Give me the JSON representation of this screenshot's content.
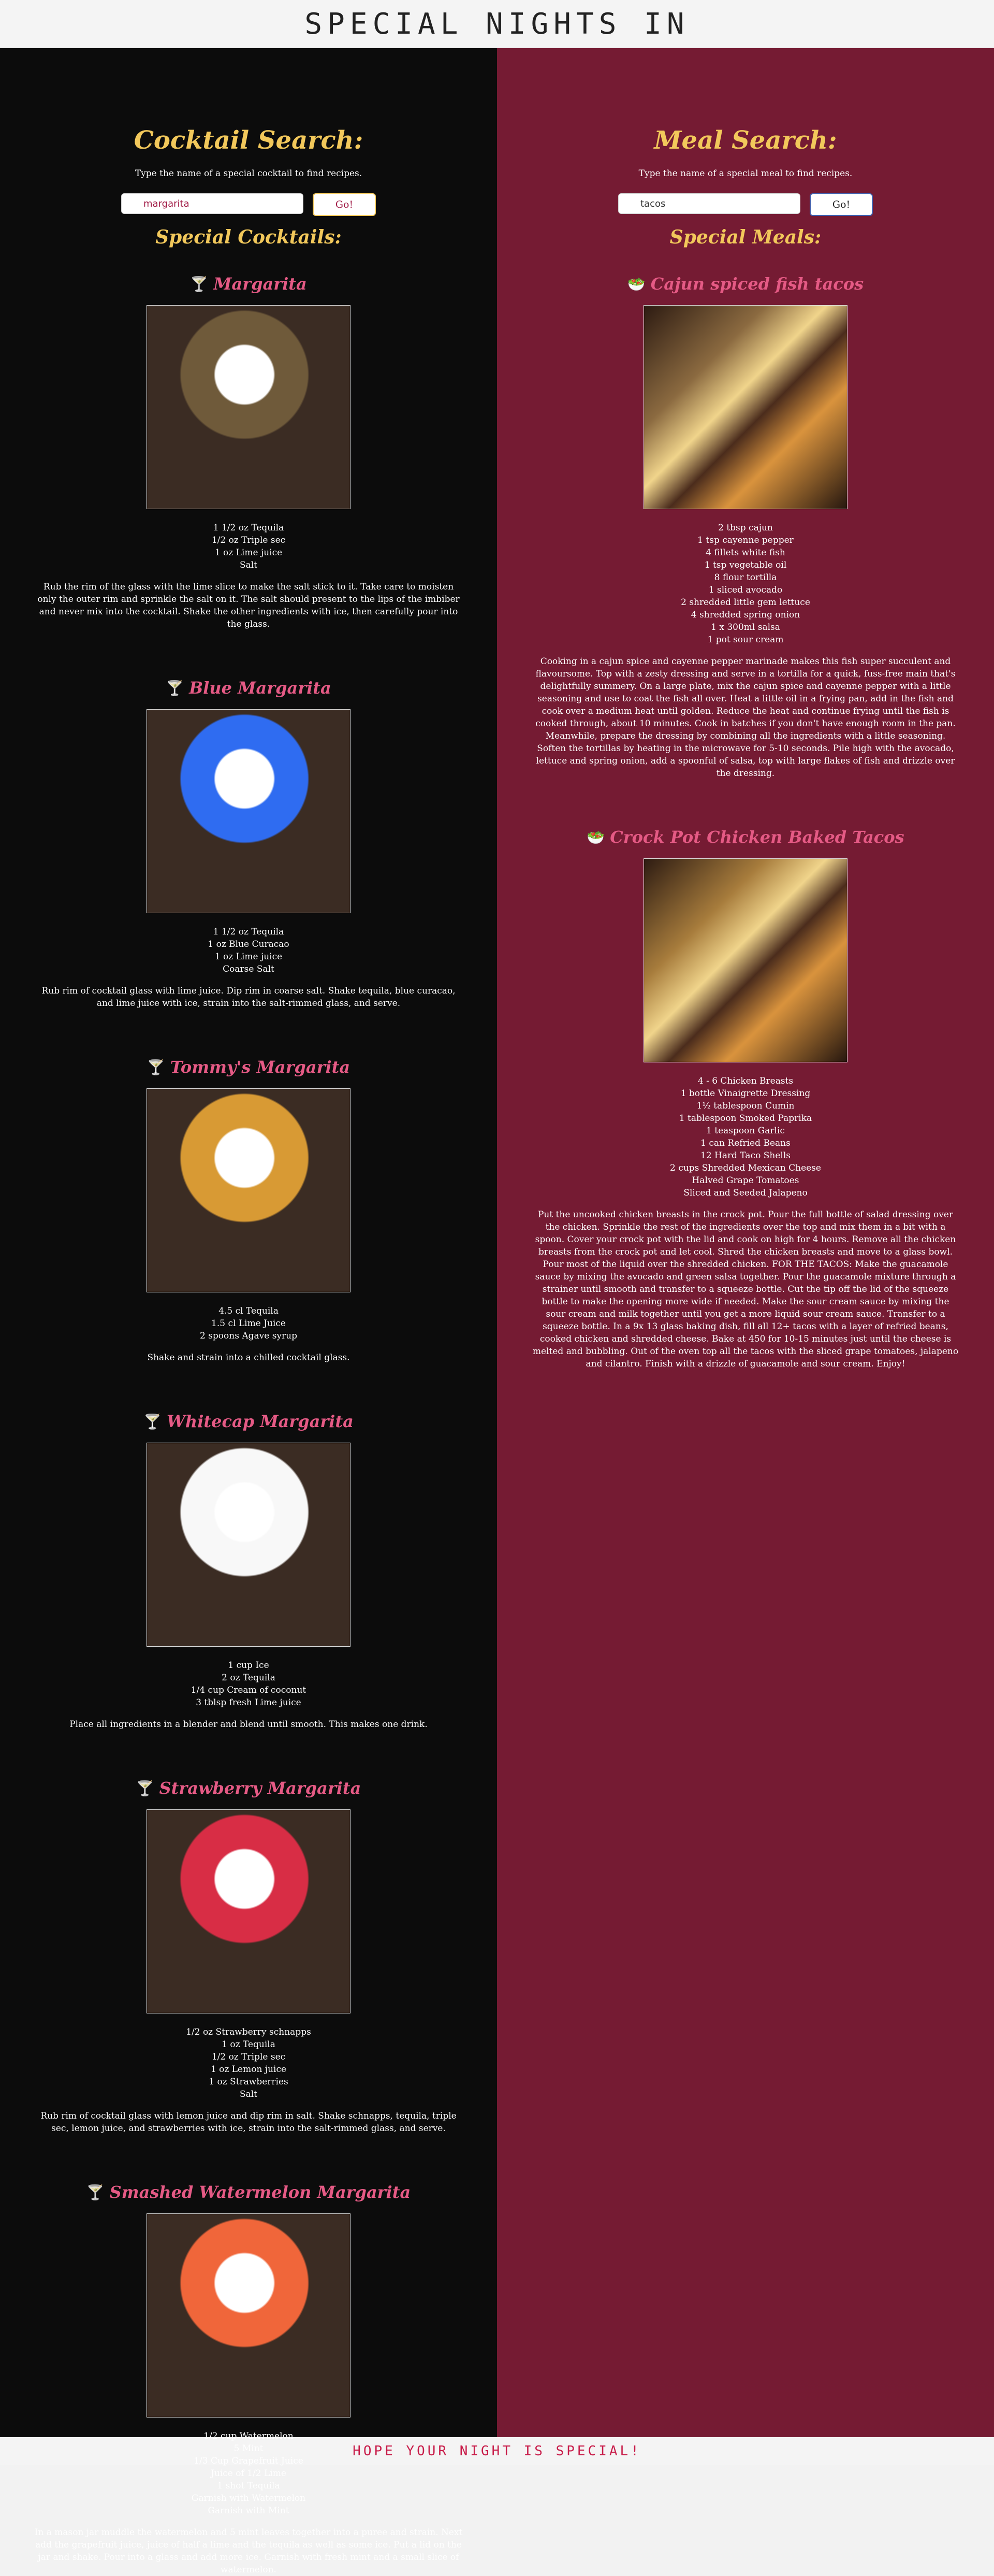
{
  "header": {
    "title": "SPECIAL NIGHTS IN"
  },
  "cocktail_search": {
    "title": "Cocktail Search:",
    "subtitle": "Type the name of a special cocktail to find recipes.",
    "input_value": "margarita",
    "button_label": "Go!",
    "special_title": "Special Cocktails:"
  },
  "meal_search": {
    "title": "Meal Search:",
    "subtitle": "Type the name of a special meal to find recipes.",
    "input_value": "tacos",
    "button_label": "Go!",
    "special_title": "Special Meals:"
  },
  "cocktails": [
    {
      "title": "Margarita",
      "ingredients": [
        "1 1/2 oz Tequila",
        "1/2 oz Triple sec",
        "1 oz Lime juice",
        "Salt"
      ],
      "description": "Rub the rim of the glass with the lime slice to make the salt stick to it. Take care to moisten only the outer rim and sprinkle the salt on it. The salt should present to the lips of the imbiber and never mix into the cocktail. Shake the other ingredients with ice, then carefully pour into the glass."
    },
    {
      "title": "Blue Margarita",
      "ingredients": [
        "1 1/2 oz Tequila",
        "1 oz Blue Curacao",
        "1 oz Lime juice",
        "Coarse Salt"
      ],
      "description": "Rub rim of cocktail glass with lime juice. Dip rim in coarse salt. Shake tequila, blue curacao, and lime juice with ice, strain into the salt-rimmed glass, and serve."
    },
    {
      "title": "Tommy's Margarita",
      "ingredients": [
        "4.5 cl Tequila",
        "1.5 cl Lime Juice",
        "2 spoons Agave syrup"
      ],
      "description": "Shake and strain into a chilled cocktail glass."
    },
    {
      "title": "Whitecap Margarita",
      "ingredients": [
        "1 cup Ice",
        "2 oz Tequila",
        "1/4 cup Cream of coconut",
        "3 tblsp fresh Lime juice"
      ],
      "description": "Place all ingredients in a blender and blend until smooth. This makes one drink."
    },
    {
      "title": "Strawberry Margarita",
      "ingredients": [
        "1/2 oz Strawberry schnapps",
        "1 oz Tequila",
        "1/2 oz Triple sec",
        "1 oz Lemon juice",
        "1 oz Strawberries",
        "Salt"
      ],
      "description": "Rub rim of cocktail glass with lemon juice and dip rim in salt. Shake schnapps, tequila, triple sec, lemon juice, and strawberries with ice, strain into the salt-rimmed glass, and serve."
    },
    {
      "title": "Smashed Watermelon Margarita",
      "ingredients": [
        "1/2 cup Watermelon",
        "5 Mint",
        "1/3 Cup Grapefruit Juice",
        "Juice of 1/2 Lime",
        "1 shot Tequila",
        "Garnish with Watermelon",
        "Garnish with Mint"
      ],
      "description": "In a mason jar muddle the watermelon and 5 mint leaves together into a puree and strain. Next add the grapefruit juice, juice of half a lime and the tequila as well as some ice. Put a lid on the jar and shake. Pour into a glass and add more ice. Garnish with fresh mint and a small slice of watermelon."
    }
  ],
  "meals": [
    {
      "title": "Cajun spiced fish tacos",
      "ingredients": [
        "2 tbsp cajun",
        "1 tsp cayenne pepper",
        "4 fillets white fish",
        "1 tsp vegetable oil",
        "8 flour tortilla",
        "1 sliced avocado",
        "2 shredded little gem lettuce",
        "4 shredded spring onion",
        "1 x 300ml salsa",
        "1 pot sour cream"
      ],
      "description": "Cooking in a cajun spice and cayenne pepper marinade makes this fish super succulent and flavoursome. Top with a zesty dressing and serve in a tortilla for a quick, fuss-free main that's delightfully summery. On a large plate, mix the cajun spice and cayenne pepper with a little seasoning and use to coat the fish all over. Heat a little oil in a frying pan, add in the fish and cook over a medium heat until golden. Reduce the heat and continue frying until the fish is cooked through, about 10 minutes. Cook in batches if you don't have enough room in the pan. Meanwhile, prepare the dressing by combining all the ingredients with a little seasoning. Soften the tortillas by heating in the microwave for 5-10 seconds. Pile high with the avocado, lettuce and spring onion, add a spoonful of salsa, top with large flakes of fish and drizzle over the dressing."
    },
    {
      "title": "Crock Pot Chicken Baked Tacos",
      "ingredients": [
        "4 - 6 Chicken Breasts",
        "1 bottle Vinaigrette Dressing",
        "1½ tablespoon Cumin",
        "1 tablespoon Smoked Paprika",
        "1 teaspoon Garlic",
        "1 can Refried Beans",
        "12 Hard Taco Shells",
        "2 cups Shredded Mexican Cheese",
        "Halved Grape Tomatoes",
        "Sliced and Seeded Jalapeno"
      ],
      "description": "Put the uncooked chicken breasts in the crock pot. Pour the full bottle of salad dressing over the chicken. Sprinkle the rest of the ingredients over the top and mix them in a bit with a spoon. Cover your crock pot with the lid and cook on high for 4 hours. Remove all the chicken breasts from the crock pot and let cool. Shred the chicken breasts and move to a glass bowl. Pour most of the liquid over the shredded chicken. FOR THE TACOS: Make the guacamole sauce by mixing the avocado and green salsa together. Pour the guacamole mixture through a strainer until smooth and transfer to a squeeze bottle. Cut the tip off the lid of the squeeze bottle to make the opening more wide if needed. Make the sour cream sauce by mixing the sour cream and milk together until you get a more liquid sour cream sauce. Transfer to a squeeze bottle. In a 9x 13 glass baking dish, fill all 12+ tacos with a layer of refried beans, cooked chicken and shredded cheese. Bake at 450 for 10-15 minutes just until the cheese is melted and bubbling. Out of the oven top all the tacos with the sliced grape tomatoes, jalapeno and cilantro. Finish with a drizzle of guacamole and sour cream. Enjoy!"
    }
  ],
  "footer": {
    "text": "HOPE YOUR NIGHT IS SPECIAL!"
  },
  "icons": {
    "cocktail": "cocktail-glass-icon",
    "meal": "food-bowl-icon"
  },
  "colors": {
    "left_bg": "#0c0c0c",
    "right_bg": "#751b33",
    "gold": "#f2c85b",
    "pink": "#e55a85"
  }
}
